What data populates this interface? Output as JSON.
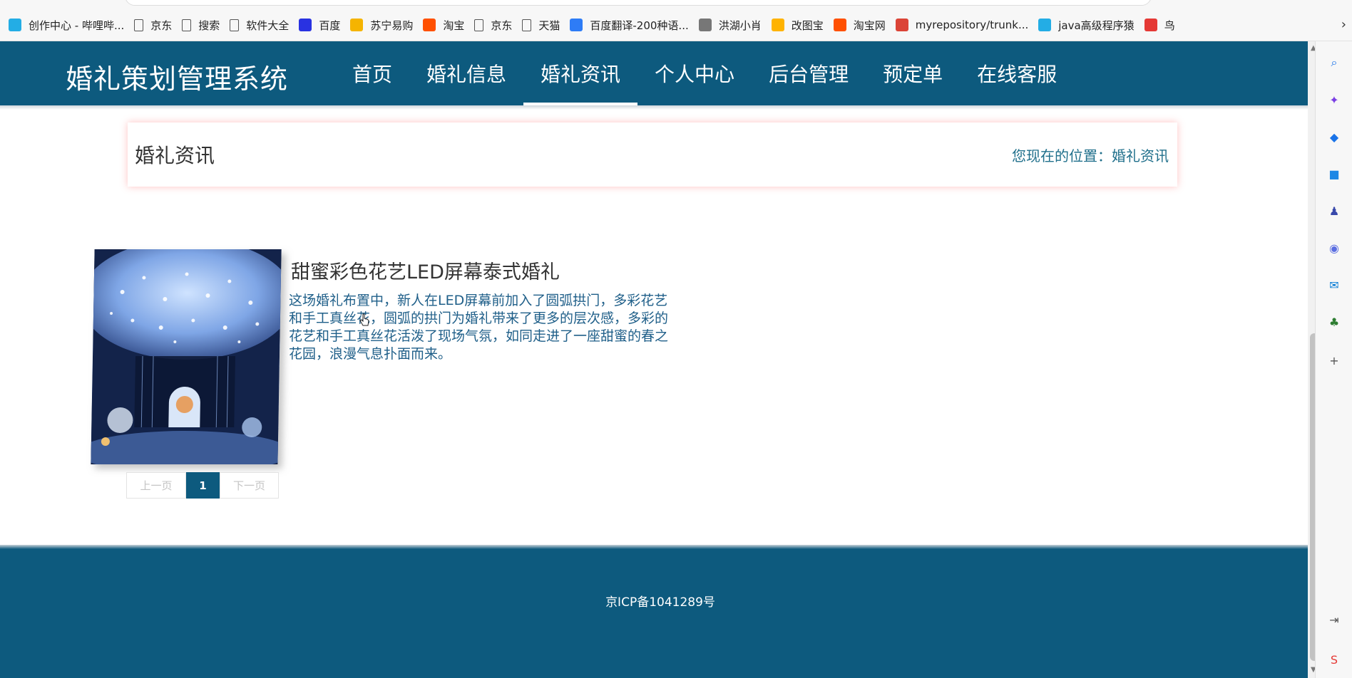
{
  "browser": {
    "bookmarks": [
      {
        "label": "创作中心 - 哔哩哔...",
        "icon": "bilibili-icon",
        "color": "#23ade5"
      },
      {
        "label": "京东",
        "icon": "file-icon"
      },
      {
        "label": "搜索",
        "icon": "file-icon"
      },
      {
        "label": "软件大全",
        "icon": "file-icon"
      },
      {
        "label": "百度",
        "icon": "baidu-paw-icon",
        "color": "#2932e1"
      },
      {
        "label": "苏宁易购",
        "icon": "suning-icon",
        "color": "#f5b400"
      },
      {
        "label": "淘宝",
        "icon": "taobao-icon",
        "color": "#ff5000"
      },
      {
        "label": "京东",
        "icon": "file-icon"
      },
      {
        "label": "天猫",
        "icon": "file-icon"
      },
      {
        "label": "百度翻译-200种语...",
        "icon": "baidu-translate-icon",
        "color": "#2e7cf6"
      },
      {
        "label": "洪湖小肖",
        "icon": "bird-icon",
        "color": "#777777"
      },
      {
        "label": "改图宝",
        "icon": "gaitubao-icon",
        "color": "#ffb300"
      },
      {
        "label": "淘宝网",
        "icon": "taobao-icon",
        "color": "#ff5000"
      },
      {
        "label": "myrepository/trunk...",
        "icon": "chrome-icon",
        "color": "#db4437"
      },
      {
        "label": "java高级程序猿",
        "icon": "bilibili-icon",
        "color": "#23ade5"
      },
      {
        "label": "鸟",
        "icon": "bird-icon",
        "color": "#e53935"
      }
    ],
    "more_label": "›"
  },
  "site": {
    "brand": "婚礼策划管理系统",
    "nav": [
      {
        "label": "首页"
      },
      {
        "label": "婚礼信息"
      },
      {
        "label": "婚礼资讯"
      },
      {
        "label": "个人中心"
      },
      {
        "label": "后台管理"
      },
      {
        "label": "预定单"
      },
      {
        "label": "在线客服"
      }
    ],
    "active_nav": "婚礼资讯"
  },
  "title_box": {
    "title": "婚礼资讯",
    "location_label": "您现在的位置：",
    "location_link": "婚礼资讯"
  },
  "news": {
    "title": "甜蜜彩色花艺LED屏幕泰式婚礼",
    "description": "这场婚礼布置中，新人在LED屏幕前加入了圆弧拱门，多彩花艺和手工真丝花，圆弧的拱门为婚礼带来了更多的层次感，多彩的花艺和手工真丝花活泼了现场气氛，如同走进了一座甜蜜的春之花园，浪漫气息扑面而来。"
  },
  "pagination": {
    "prev": "上一页",
    "current": "1",
    "next": "下一页"
  },
  "footer": {
    "icp": "京ICP备1041289号"
  },
  "colors": {
    "primary": "#0d5a7e",
    "link": "#1f6f8b",
    "shadow_accent": "#ff7878"
  }
}
